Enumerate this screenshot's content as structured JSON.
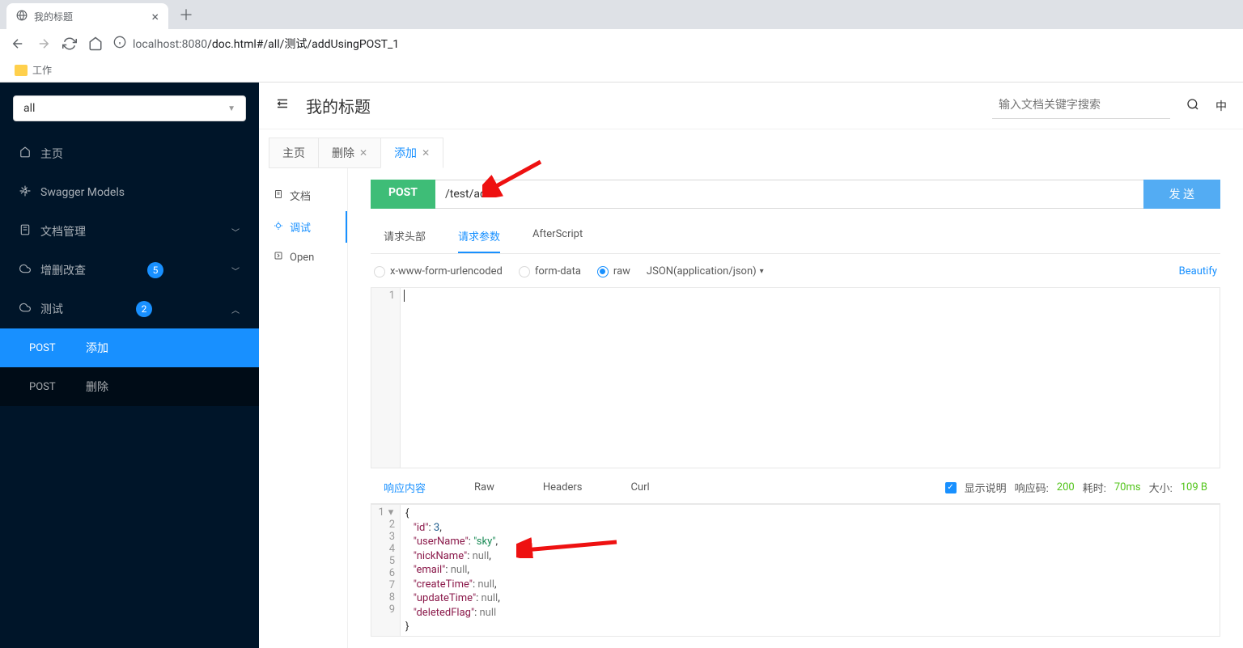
{
  "browser": {
    "tab_title": "我的标题",
    "url_host": "localhost:",
    "url_port": "8080",
    "url_path": "/doc.html#/all/测试/addUsingPOST_1",
    "bookmark": "工作"
  },
  "sidebar": {
    "select_value": "all",
    "items": {
      "home": "主页",
      "swagger": "Swagger Models",
      "doc_mgmt": "文档管理",
      "crud": "增删改查",
      "crud_badge": "5",
      "test": "测试",
      "test_badge": "2"
    },
    "sub": {
      "add": {
        "method": "POST",
        "label": "添加"
      },
      "del": {
        "method": "POST",
        "label": "删除"
      }
    }
  },
  "header": {
    "title": "我的标题",
    "search_placeholder": "输入文档关键字搜索",
    "lang": "中"
  },
  "content_tabs": {
    "home": "主页",
    "del": "删除",
    "add": "添加"
  },
  "left_col": {
    "doc": "文档",
    "debug": "调试",
    "open": "Open"
  },
  "api": {
    "method": "POST",
    "path": "/test/add",
    "send": "发 送"
  },
  "sub_tabs": {
    "headers": "请求头部",
    "params": "请求参数",
    "after": "AfterScript"
  },
  "body_types": {
    "form": "x-www-form-urlencoded",
    "formdata": "form-data",
    "raw": "raw",
    "json_label": "JSON(application/json)",
    "beautify": "Beautify"
  },
  "request_body": {
    "line1": "1"
  },
  "resp_tabs": {
    "content": "响应内容",
    "raw": "Raw",
    "headers": "Headers",
    "curl": "Curl"
  },
  "resp_meta": {
    "show_desc": "显示说明",
    "code_label": "响应码:",
    "code_val": "200",
    "time_label": "耗时:",
    "time_val": "70ms",
    "size_label": "大小:",
    "size_val": "109 B"
  },
  "response": {
    "lines": [
      "1",
      "2",
      "3",
      "4",
      "5",
      "6",
      "7",
      "8",
      "9"
    ],
    "json": {
      "id": 3,
      "userName": "sky",
      "nickName": null,
      "email": null,
      "createTime": null,
      "updateTime": null,
      "deletedFlag": null
    }
  }
}
